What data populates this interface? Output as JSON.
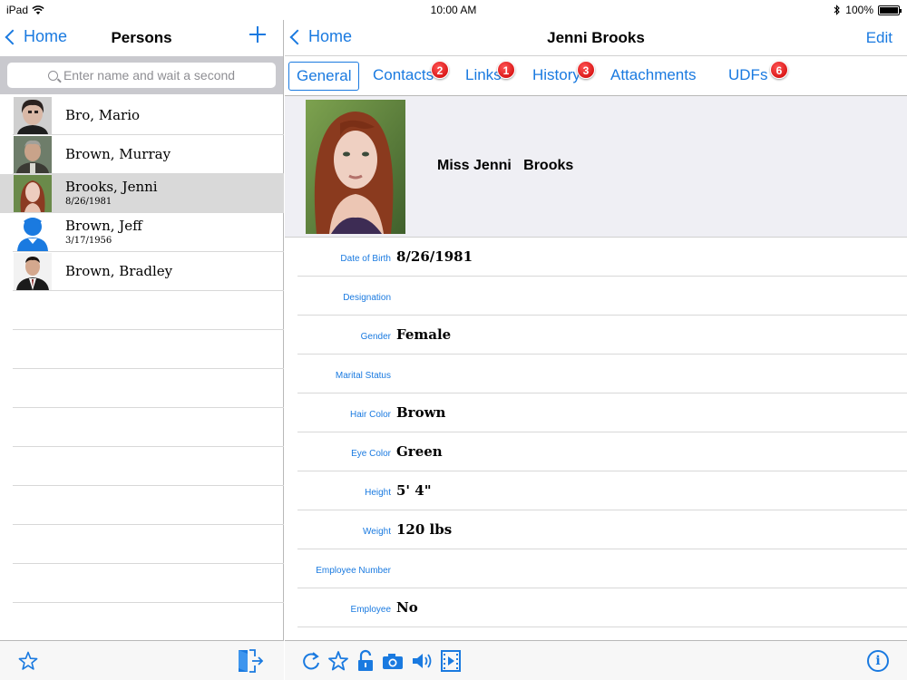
{
  "status_bar": {
    "device": "iPad",
    "time": "10:00 AM",
    "battery": "100%",
    "battery_level_percent": 100
  },
  "left_pane": {
    "back_label": "Home",
    "title": "Persons",
    "search_placeholder": "Enter name and wait a second",
    "persons": [
      {
        "name": "Bro, Mario",
        "sub": ""
      },
      {
        "name": "Brown, Murray",
        "sub": ""
      },
      {
        "name": "Brooks, Jenni",
        "sub": "8/26/1981"
      },
      {
        "name": "Brown, Jeff",
        "sub": "3/17/1956"
      },
      {
        "name": "Brown, Bradley",
        "sub": ""
      }
    ]
  },
  "right_pane": {
    "back_label": "Home",
    "title": "Jenni Brooks",
    "edit_label": "Edit",
    "tabs": [
      {
        "label": "General",
        "badge": ""
      },
      {
        "label": "Contacts",
        "badge": "2"
      },
      {
        "label": "Links",
        "badge": "1"
      },
      {
        "label": "History",
        "badge": "3"
      },
      {
        "label": "Attachments",
        "badge": ""
      },
      {
        "label": "UDFs",
        "badge": "6"
      }
    ],
    "full_name": "Miss Jenni   Brooks",
    "fields": [
      {
        "label": "Date of Birth",
        "value": "8/26/1981"
      },
      {
        "label": "Designation",
        "value": ""
      },
      {
        "label": "Gender",
        "value": "Female"
      },
      {
        "label": "Marital Status",
        "value": ""
      },
      {
        "label": "Hair Color",
        "value": "Brown"
      },
      {
        "label": "Eye Color",
        "value": "Green"
      },
      {
        "label": "Height",
        "value": "5' 4\""
      },
      {
        "label": "Weight",
        "value": "120 lbs"
      },
      {
        "label": "Employee Number",
        "value": ""
      },
      {
        "label": "Employee",
        "value": "No"
      }
    ]
  },
  "colors": {
    "accent": "#1a7ae0",
    "badge": "#cc0000",
    "selected_row": "#d9d9d9",
    "header_bg": "#efeff4"
  }
}
